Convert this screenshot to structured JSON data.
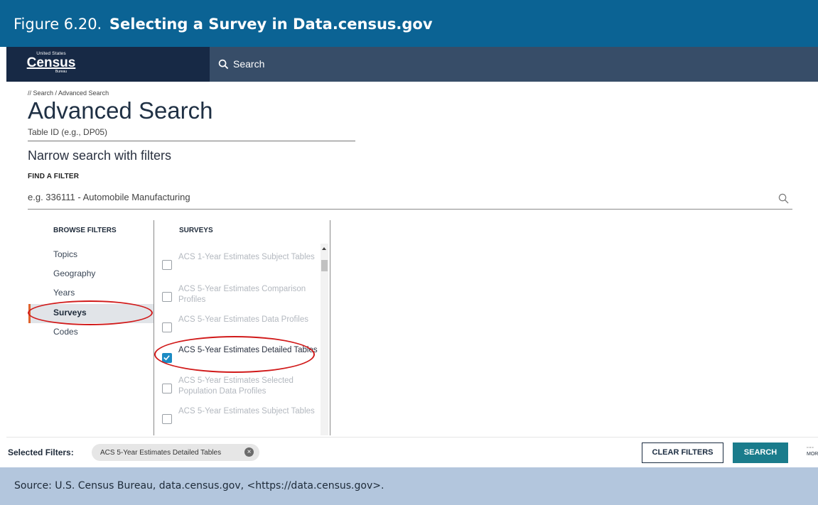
{
  "figure": {
    "number": "Figure 6.20.",
    "title": "Selecting a Survey in Data.census.gov"
  },
  "logo": {
    "top": "United States",
    "main": "Census",
    "sub": "Bureau"
  },
  "header": {
    "search_label": "Search",
    "icon": "search-icon"
  },
  "breadcrumb": "// Search / Advanced Search",
  "page_title": "Advanced Search",
  "table_id": {
    "placeholder": "Table ID (e.g., DP05)"
  },
  "narrow_heading": "Narrow search with filters",
  "find_filter": {
    "label": "FIND A FILTER",
    "placeholder": "e.g. 336111 - Automobile Manufacturing",
    "icon": "search-icon"
  },
  "browse_filters": {
    "heading": "BROWSE FILTERS",
    "items": [
      "Topics",
      "Geography",
      "Years",
      "Surveys",
      "Codes"
    ],
    "active": "Surveys"
  },
  "surveys": {
    "heading": "SURVEYS",
    "items": [
      {
        "label": "ACS 1-Year Estimates Subject Tables",
        "checked": false
      },
      {
        "label": "ACS 5-Year Estimates Comparison Profiles",
        "checked": false
      },
      {
        "label": "ACS 5-Year Estimates Data Profiles",
        "checked": false
      },
      {
        "label": "ACS 5-Year Estimates Detailed Tables",
        "checked": true
      },
      {
        "label": "ACS 5-Year Estimates Selected Population Data Profiles",
        "checked": false
      },
      {
        "label": "ACS 5-Year Estimates Subject Tables",
        "checked": false
      }
    ]
  },
  "selected_filters": {
    "label": "Selected Filters:",
    "chips": [
      "ACS 5-Year Estimates Detailed Tables"
    ]
  },
  "actions": {
    "clear": "CLEAR FILTERS",
    "search": "SEARCH",
    "more": "MOR"
  },
  "source": "Source: U.S. Census Bureau, data.census.gov, <https://data.census.gov>.",
  "colors": {
    "title_bar": "#0b6394",
    "nav_dark": "#172945",
    "nav": "#374d68",
    "accent_orange": "#e0642e",
    "checkbox_blue": "#1c8bc4",
    "search_button": "#1a7c8c",
    "highlight_red": "#d11a1a",
    "source_bar": "#b3c6dd"
  }
}
